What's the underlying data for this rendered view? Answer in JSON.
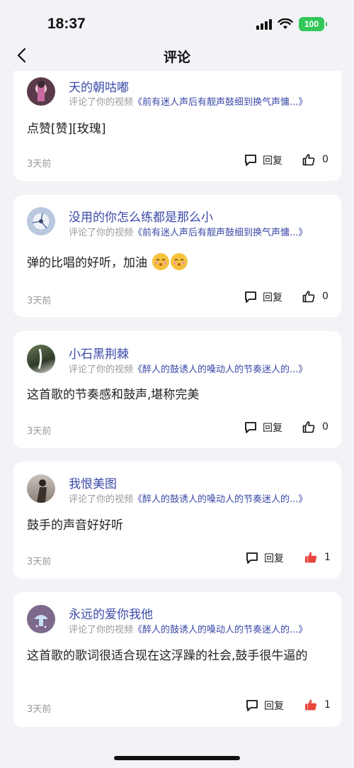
{
  "status_bar": {
    "time": "18:37",
    "battery": "100"
  },
  "header": {
    "title": "评论"
  },
  "comments": [
    {
      "username": "天的朝咕嘟",
      "action": "评论了你的视频",
      "video_title": "《前有迷人声后有靓声鼓细到换气声慵...》",
      "content": "点赞[赞][玫瑰]",
      "time": "3天前",
      "reply_label": "回复",
      "like_count": "0",
      "liked": false
    },
    {
      "username": "没用的你怎么练都是那么小",
      "action": "评论了你的视频",
      "video_title": "《前有迷人声后有靓声鼓细到换气声慵...》",
      "content": "弹的比唱的好听，加油",
      "time": "3天前",
      "reply_label": "回复",
      "like_count": "0",
      "liked": false
    },
    {
      "username": "小石黑荆棘",
      "action": "评论了你的视频",
      "video_title": "《醉人的鼓诱人的嗓动人的节奏迷人的...》",
      "content": "这首歌的节奏感和鼓声,堪称完美",
      "time": "3天前",
      "reply_label": "回复",
      "like_count": "0",
      "liked": false
    },
    {
      "username": "我恨美图",
      "action": "评论了你的视频",
      "video_title": "《醉人的鼓诱人的嗓动人的节奏迷人的...》",
      "content": "鼓手的声音好好听",
      "time": "3天前",
      "reply_label": "回复",
      "like_count": "1",
      "liked": true
    },
    {
      "username": "永远的爱你我他",
      "action": "评论了你的视频",
      "video_title": "《醉人的鼓诱人的嗓动人的节奏迷人的...》",
      "content": "这首歌的歌词很适合现在这浮躁的社会,鼓手很牛逼的",
      "time": "3天前",
      "reply_label": "回复",
      "like_count": "1",
      "liked": true
    }
  ],
  "colors": {
    "accent": "#3b4aa8",
    "liked": "#e8453c",
    "background": "#f2f3f7"
  }
}
